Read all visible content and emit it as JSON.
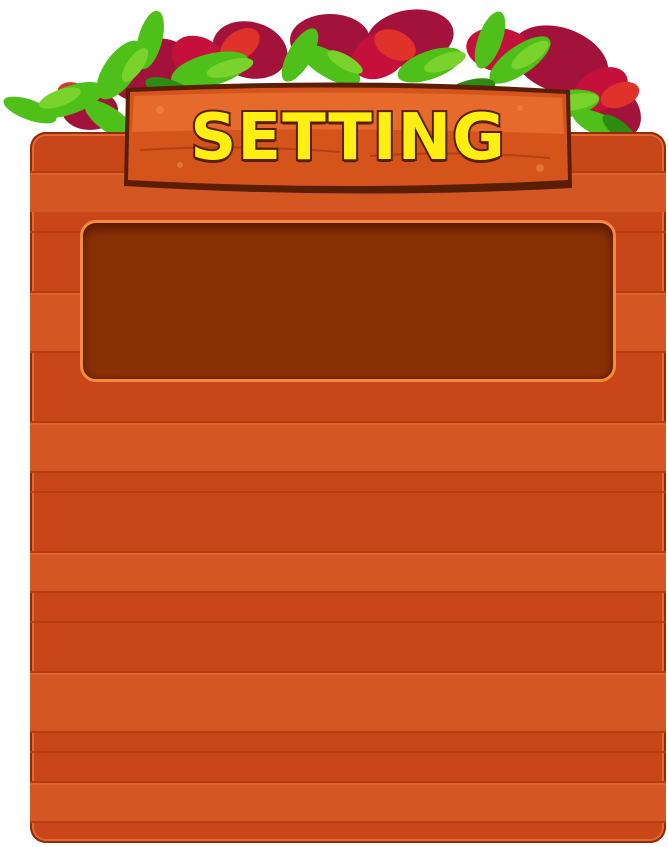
{
  "dialog": {
    "title": "SETTING",
    "title_color": "#ffee12",
    "board_color": "#c9461a",
    "panel_color": "#8a3005",
    "decoration": "leaf-bush"
  }
}
